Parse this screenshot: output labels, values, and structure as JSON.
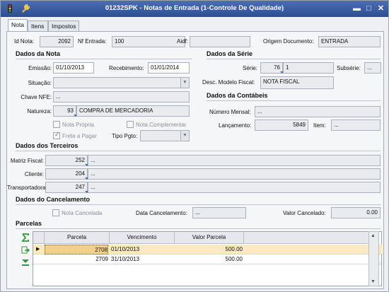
{
  "window": {
    "title": "01232SPK - Notas de Entrada (1-Controle De Qualidade)",
    "icons": [
      "traffic-light-icon",
      "wrench-icon"
    ],
    "controls": [
      "minimize-icon",
      "maximize-icon",
      "close-icon"
    ]
  },
  "tabs": [
    "Nota",
    "Itens",
    "Impostos"
  ],
  "header": {
    "id_nota_label": "Id Nota:",
    "id_nota": "2092",
    "nf_entrada_label": "Nf Entrada:",
    "nf_entrada": "100",
    "aidf_label": "Aidf:",
    "aidf": "",
    "origem_label": "Origem Documento:",
    "origem": "ENTRADA"
  },
  "dados_nota": {
    "title": "Dados da Nota",
    "emissao_label": "Emissão:",
    "emissao": "01/10/2013",
    "recebimento_label": "Recebimento:",
    "recebimento": "01/01/2014",
    "situacao_label": "Situação:",
    "situacao": "",
    "chave_label": "Chave NFE:",
    "chave": "...",
    "natureza_label": "Natureza:",
    "natureza_code": "93",
    "natureza_desc": "COMPRA DE MERCADORIA",
    "nota_propria": "Nota Própria",
    "nota_complementar": "Nota Complementar",
    "frete_pagar": "Frete a Pagar",
    "tipo_pgto_label": "Tipo Pgto:",
    "tipo_pgto": ""
  },
  "dados_serie": {
    "title": "Dados da Série",
    "serie_label": "Série:",
    "serie_code": "76",
    "serie_desc": "1",
    "subserie_label": "Subsérie:",
    "subserie": "...",
    "modelo_label": "Desc. Modelo Fiscal:",
    "modelo": "NOTA FISCAL"
  },
  "dados_contabeis": {
    "title": "Dados da Contábeis",
    "numero_mensal_label": "Número Mensal:",
    "numero_mensal": "...",
    "lancamento_label": "Lançamento:",
    "lancamento": "5849",
    "item_label": "Item:",
    "item": "..."
  },
  "terceiros": {
    "title": "Dados dos Terceiros",
    "matriz_label": "Matriz Fiscal:",
    "matriz_code": "252",
    "matriz_desc": "...",
    "cliente_label": "Cliente:",
    "cliente_code": "204",
    "cliente_desc": "...",
    "transp_label": "Transportadora:",
    "transp_code": "247",
    "transp_desc": "..."
  },
  "cancelamento": {
    "title": "Dados do Cancelamento",
    "nota_cancelada": "Nota Cancelada",
    "data_label": "Data Cancelamento:",
    "data": "...",
    "valor_label": "Valor Cancelado:",
    "valor": "0.00"
  },
  "parcelas": {
    "title": "Parcelas",
    "columns": [
      "Parcela",
      "Vencimento",
      "Valor Parcela"
    ],
    "rows": [
      {
        "parcela": "2708",
        "vencimento": "01/10/2013",
        "valor": "500.00"
      },
      {
        "parcela": "2709",
        "vencimento": "31/10/2013",
        "valor": "500.00"
      }
    ],
    "side_icons": [
      "sum-icon",
      "export-icon",
      "expand-down-icon"
    ]
  }
}
